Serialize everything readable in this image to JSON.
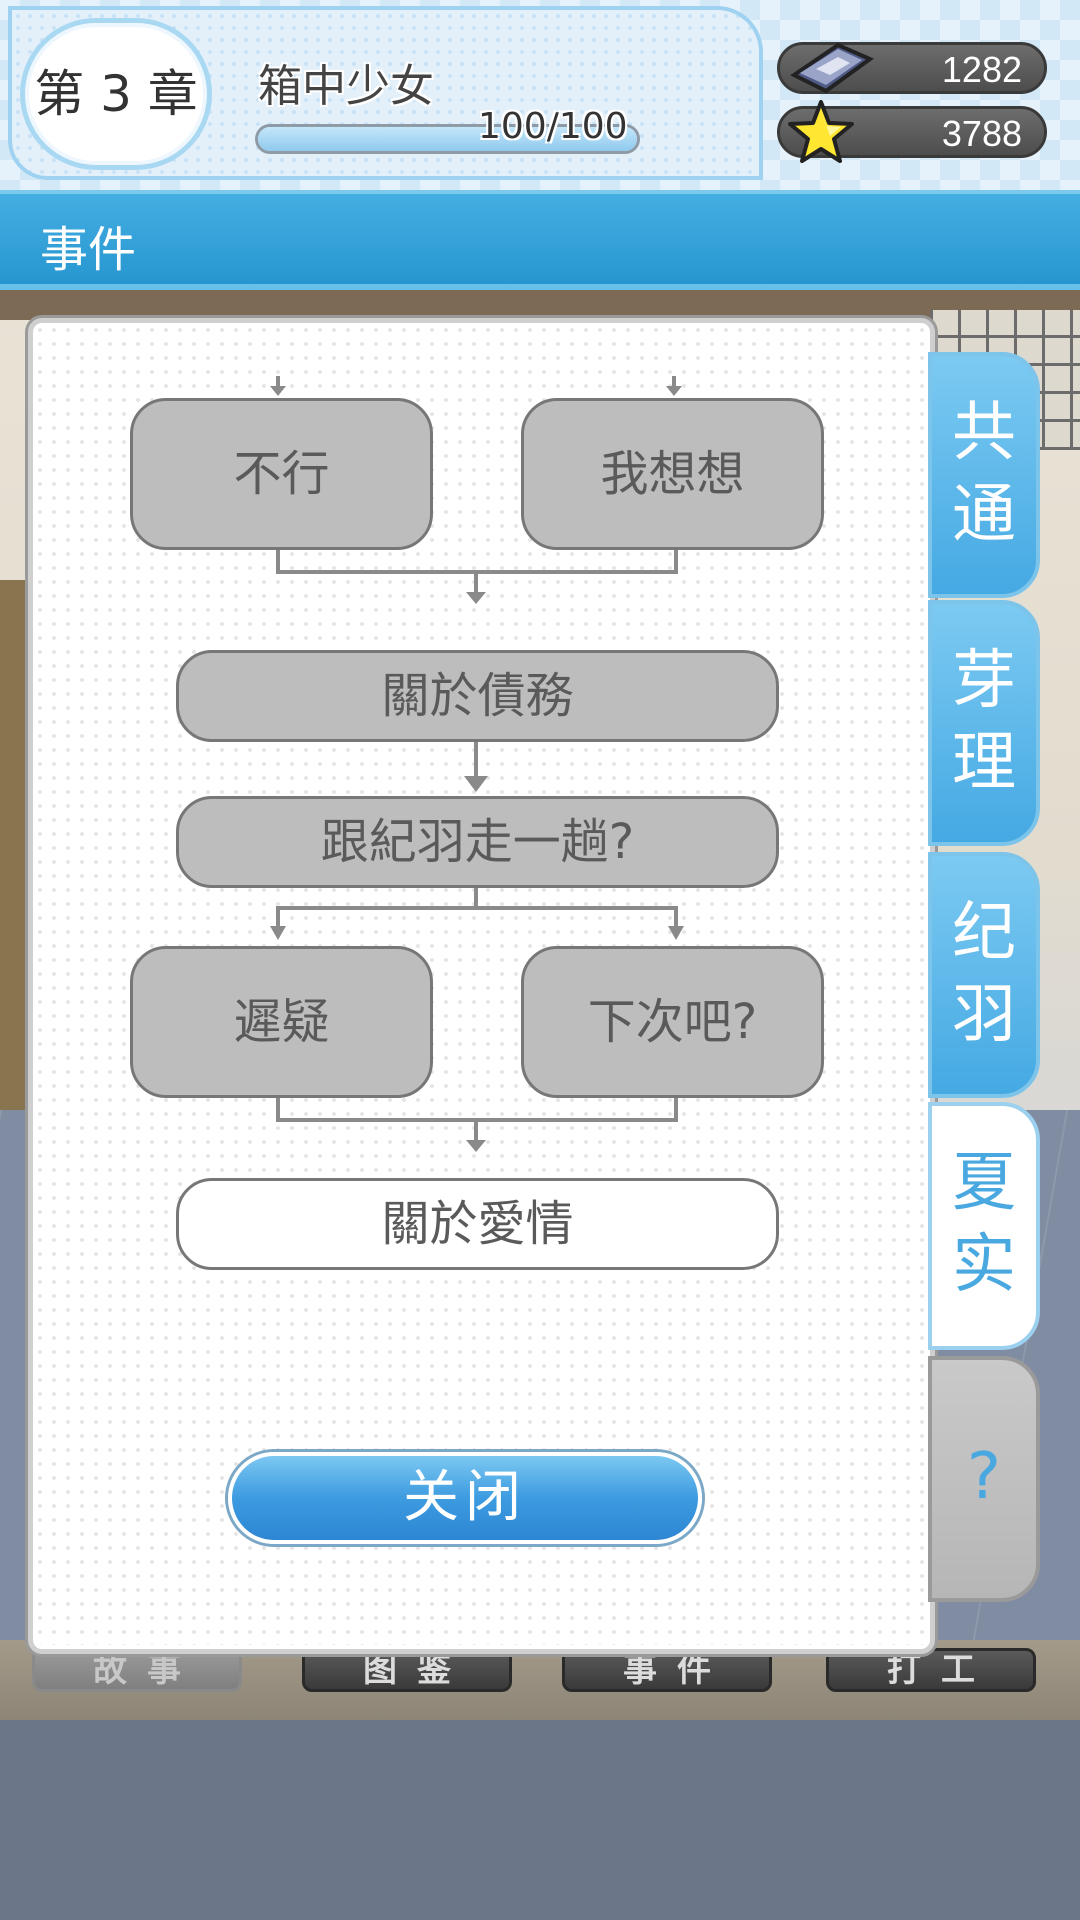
{
  "header": {
    "chapter_label": "第 3 章",
    "chapter_title": "箱中少女",
    "progress_text": "100/100",
    "progress_fraction": 1.0,
    "currency_gem": "1282",
    "currency_star": "3788",
    "gem_icon": "gem-ticket-icon",
    "star_icon": "star-icon"
  },
  "section": {
    "title": "事件"
  },
  "flow": {
    "nodes": {
      "n1": "不行",
      "n2": "我想想",
      "n3": "關於債務",
      "n4": "跟紀羽走一趟?",
      "n5": "遲疑",
      "n6": "下次吧?",
      "n7": "關於愛情"
    },
    "active_node": "關於愛情"
  },
  "dialog": {
    "close_label": "关闭"
  },
  "tabs": [
    {
      "line1": "共",
      "line2": "通"
    },
    {
      "line1": "芽",
      "line2": "理"
    },
    {
      "line1": "纪",
      "line2": "羽"
    },
    {
      "line1": "夏",
      "line2": "实",
      "selected": true
    },
    {
      "line1": "?",
      "line2": "",
      "locked": true
    }
  ],
  "bottom_nav": {
    "items": [
      "故事",
      "图鉴",
      "事件",
      "打工"
    ]
  },
  "colors": {
    "accent_blue": "#2796d0",
    "node_gray": "#bdbdbd",
    "node_active": "#ffffff"
  }
}
